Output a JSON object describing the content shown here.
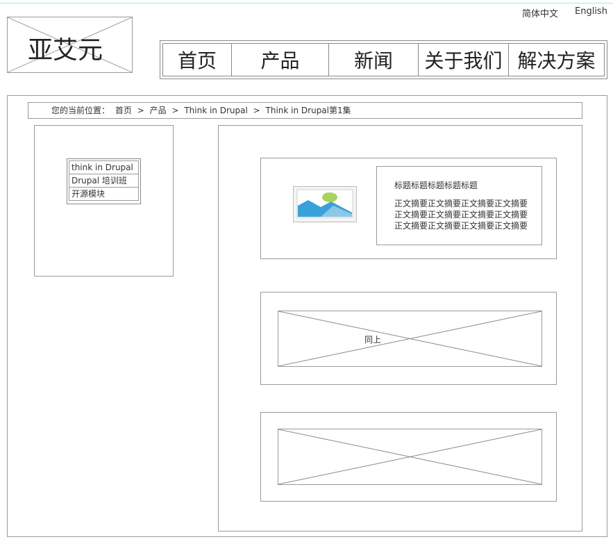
{
  "header": {
    "logo_text": "亚艾元",
    "languages": [
      "简体中文",
      "English"
    ]
  },
  "nav": {
    "items": [
      "首页",
      "产品",
      "新闻",
      "关于我们",
      "解决方案"
    ]
  },
  "breadcrumb": {
    "prefix": "您的当前位置：",
    "items": [
      "首页",
      "产品",
      "Think in Drupal",
      "Think in Drupal第1集"
    ],
    "separator": ">"
  },
  "sidebar": {
    "items": [
      "think in Drupal",
      "Drupal 培训班",
      "开源模块"
    ]
  },
  "article": {
    "title": "标题标题标题标题标题",
    "summary": "正文摘要正文摘要正文摘要正文摘要正文摘要正文摘要正文摘要正文摘要正文摘要正文摘要正文摘要正文摘要"
  },
  "placeholder": {
    "same_label": "同上"
  },
  "colors": {
    "border": "#999999",
    "top_line": "#9ee6f0",
    "image_sky": "#3aa0d8",
    "image_sun": "#a9d25a"
  }
}
